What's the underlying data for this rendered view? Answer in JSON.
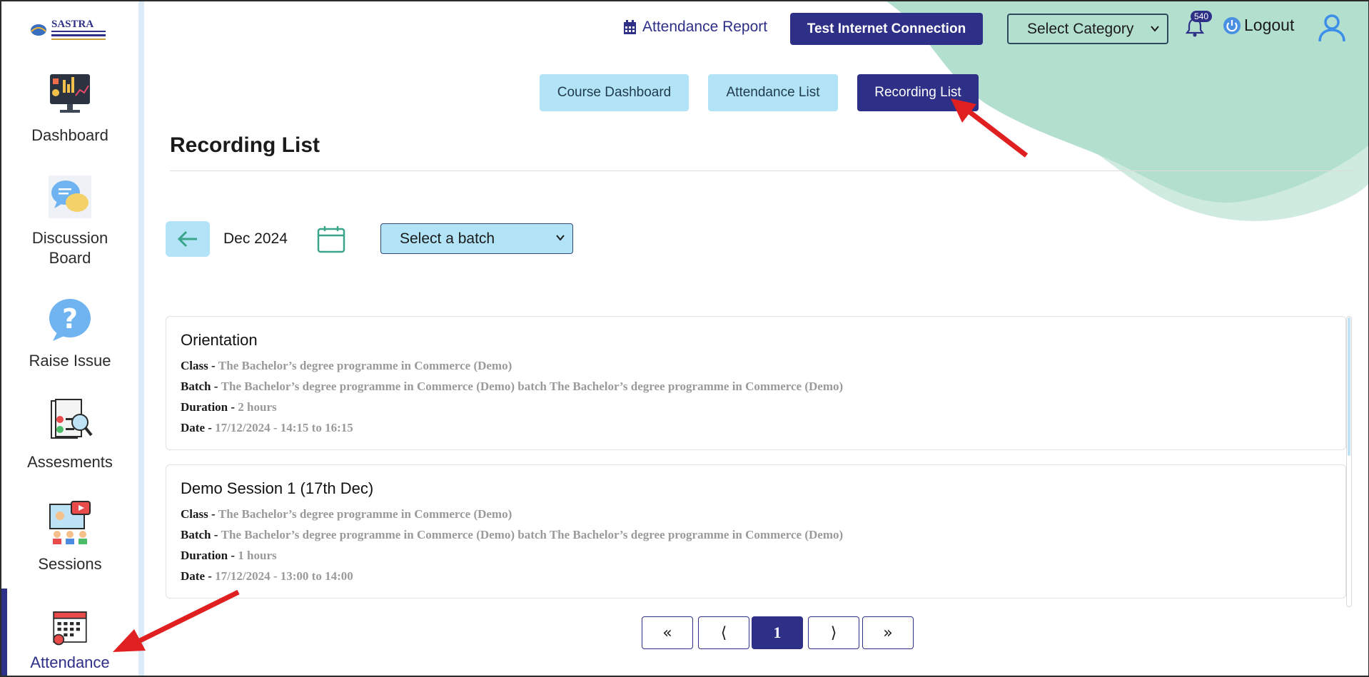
{
  "brand": {
    "logo_text": "SASTRA"
  },
  "sidebar": {
    "items": [
      {
        "label": "Dashboard",
        "icon": "dashboard-icon"
      },
      {
        "label": "Discussion Board",
        "icon": "discussion-icon"
      },
      {
        "label": "Raise Issue",
        "icon": "question-icon"
      },
      {
        "label": "Assesments",
        "icon": "assessment-icon"
      },
      {
        "label": "Sessions",
        "icon": "sessions-icon"
      },
      {
        "label": "Attendance",
        "icon": "attendance-icon",
        "active": true
      }
    ]
  },
  "header": {
    "attendance_report": "Attendance Report",
    "test_connection": "Test Internet Connection",
    "select_category": "Select Category",
    "notification_count": "540",
    "logout": "Logout"
  },
  "tabs": [
    {
      "label": "Course Dashboard"
    },
    {
      "label": "Attendance List"
    },
    {
      "label": "Recording List",
      "active": true
    }
  ],
  "page_title": "Recording List",
  "filters": {
    "month": "Dec 2024",
    "batch_placeholder": "Select a batch"
  },
  "recordings": [
    {
      "title": "Orientation",
      "class_label": "Class -",
      "class": "The Bachelor’s degree programme in Commerce (Demo)",
      "batch_label": "Batch -",
      "batch": "The Bachelor’s degree programme in Commerce (Demo) batch The Bachelor’s degree programme in Commerce (Demo)",
      "duration_label": "Duration -",
      "duration": "2 hours",
      "date_label": "Date -",
      "date": "17/12/2024 - 14:15 to 16:15"
    },
    {
      "title": "Demo Session 1 (17th Dec)",
      "class_label": "Class -",
      "class": "The Bachelor’s degree programme in Commerce (Demo)",
      "batch_label": "Batch -",
      "batch": "The Bachelor’s degree programme in Commerce (Demo) batch The Bachelor’s degree programme in Commerce (Demo)",
      "duration_label": "Duration -",
      "duration": "1 hours",
      "date_label": "Date -",
      "date": "17/12/2024 - 13:00 to 14:00"
    }
  ],
  "pagination": {
    "first": "«",
    "prev": "⟨",
    "current": "1",
    "next": "⟩",
    "last": "»"
  },
  "colors": {
    "primary": "#2e2f87",
    "light_tab": "#b3e3f6",
    "wave": "#b3dfcf",
    "annotation_arrow": "#e02020"
  }
}
